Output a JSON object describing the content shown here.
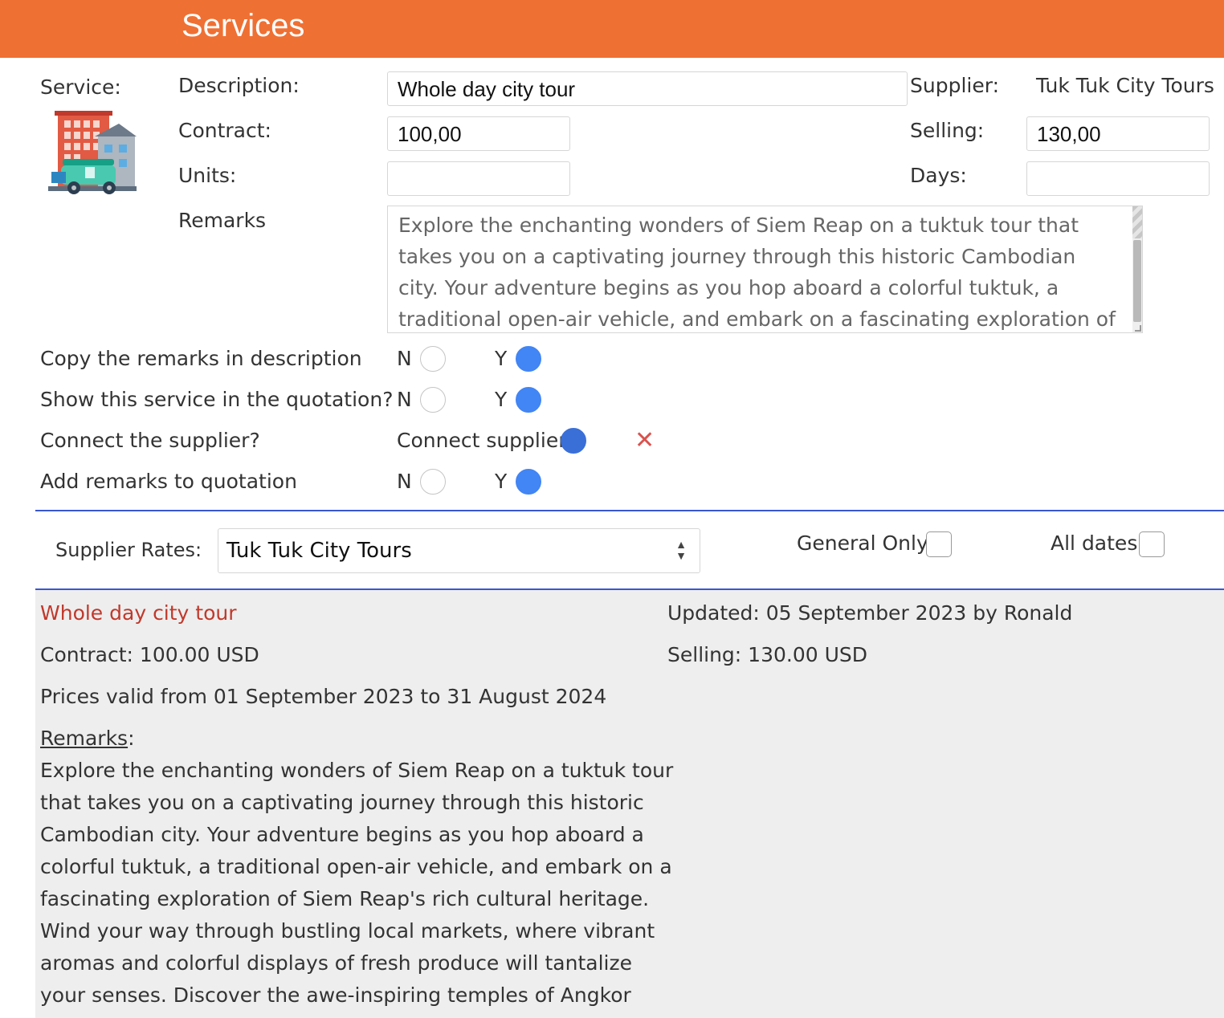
{
  "header": {
    "title": "Services"
  },
  "form": {
    "service_label": "Service:",
    "description_label": "Description:",
    "description_value": "Whole day city tour",
    "supplier_label": "Supplier:",
    "supplier_value": "Tuk Tuk City Tours",
    "contract_label": "Contract:",
    "contract_value": "100,00",
    "selling_label": "Selling:",
    "selling_value": "130,00",
    "units_label": "Units:",
    "units_value": "",
    "days_label": "Days:",
    "days_value": "",
    "remarks_label": "Remarks",
    "remarks_value": "Explore the enchanting wonders of Siem Reap on a tuktuk tour that takes you on a captivating journey through this historic Cambodian city. Your adventure begins as you hop aboard a colorful tuktuk, a traditional open-air vehicle, and embark on a fascinating exploration of Siem Reap's rich cultural heritage."
  },
  "options": {
    "copy_remarks": {
      "label": "Copy the remarks in description",
      "n": "N",
      "y": "Y",
      "selected": "Y"
    },
    "show_in_quotation": {
      "label": "Show this service in the quotation?",
      "n": "N",
      "y": "Y",
      "selected": "Y"
    },
    "connect_supplier": {
      "label": "Connect the supplier?",
      "option_label": "Connect supplier",
      "selected": true,
      "clear_symbol": "✕"
    },
    "add_remarks": {
      "label": "Add remarks to quotation",
      "n": "N",
      "y": "Y",
      "selected": "Y"
    }
  },
  "rates": {
    "label": "Supplier Rates:",
    "selected": "Tuk Tuk City Tours",
    "general_only_label": "General Only",
    "general_only_checked": false,
    "all_dates_label": "All dates",
    "all_dates_checked": false
  },
  "details": {
    "title": "Whole day city tour",
    "updated": "Updated: 05 September 2023 by Ronald",
    "contract": "Contract: 100.00 USD",
    "selling": "Selling: 130.00 USD",
    "validity": "Prices valid from 01 September 2023 to 31 August 2024",
    "remarks_heading": "Remarks",
    "remarks_colon": ":",
    "remarks_text": "Explore the enchanting wonders of Siem Reap on a tuktuk tour that takes you on a captivating journey through this historic Cambodian city. Your adventure begins as you hop aboard a colorful tuktuk, a traditional open-air vehicle, and embark on a fascinating exploration of Siem Reap's rich cultural heritage. Wind your way through bustling local markets, where vibrant aromas and colorful displays of fresh produce will tantalize your senses. Discover the awe-inspiring temples of Angkor Wat, a UNESCO World Heritage"
  },
  "colors": {
    "header": "#ef7033",
    "radio_on": "#4285f4",
    "divider": "#3a57cf",
    "detail_title": "#c0392b"
  },
  "icons": {
    "service_icon": "city-tuktuk-icon",
    "select_arrows": "updown-arrows-icon",
    "clear": "close-icon"
  }
}
